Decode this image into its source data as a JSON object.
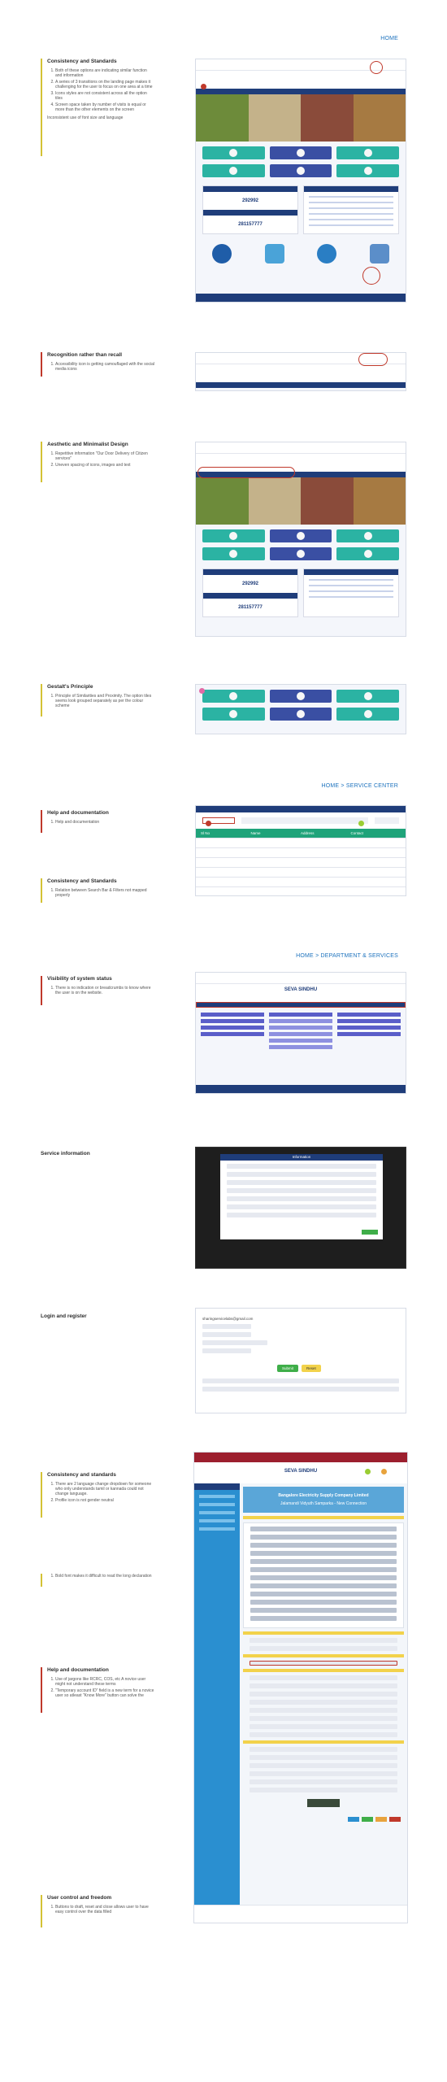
{
  "sections": {
    "home": "HOME",
    "service_center": "HOME > SERVICE CENTER",
    "dept_services": "HOME > DEPARTMENT & SERVICES"
  },
  "notes": {
    "consistency1": {
      "title": "Consistency and Standards",
      "items": [
        "Both of these options are indicating similar function and information",
        "A series of 3 transitions on the landing page makes it challenging for the user to focus on one area at a time",
        "Icons styles are not consistent across all the option tiles",
        "Screen space taken by number of visits is equal or more than the other elements on the screen"
      ],
      "extra": "Inconsistent use of font size and language"
    },
    "recognition": {
      "title": "Recognition rather than recall",
      "items": [
        "Accessibility icon is getting camouflaged with the social media icons"
      ]
    },
    "aesthetic": {
      "title": "Aesthetic and Minimalist Design",
      "items": [
        "Repetitive information \"Our Door Delivery of Citizen services\"",
        "Uneven spacing of icons, images and text"
      ]
    },
    "gestalt": {
      "title": "Gestalt's Principle",
      "items": [
        "Principle of Similarities and Proximity. The option tiles seems look grouped separately as per the colour scheme"
      ]
    },
    "help1": {
      "title": "Help and documentation",
      "items": [
        "Help and documentation"
      ]
    },
    "consistency2": {
      "title": "Consistency and Standards",
      "items": [
        "Relation between Search Bar & Filters not mapped properly"
      ]
    },
    "visibility": {
      "title": "Visibility of system status",
      "items": [
        "There is no indication or breadcrumbs to know where the user is on the website."
      ]
    },
    "service_info": {
      "title": "Service information"
    },
    "login": {
      "title": "Login and register"
    },
    "consistency3": {
      "title": "Consistency and standards",
      "items": [
        "There are 2 language change dropdown for someone who only understands tamil or kannada could not change language.",
        "Profile icon is not gender neutral"
      ]
    },
    "bold": {
      "items": [
        "Bold font makes it difficult to read the long declaration"
      ]
    },
    "help2": {
      "title": "Help and documentation",
      "items": [
        "Use of jargons like RCRC, COS, etc A novice user might not understand these terms",
        "\"Temporary account ID\" field is a new term for a novice user so atleast \"Know More\" button can solve the"
      ]
    },
    "control": {
      "title": "User control and freedom",
      "items": [
        "Buttons to draft, reset and close allows user to have easy control over the data filled"
      ]
    }
  },
  "shots": {
    "home_visits": "292992",
    "home_today": "281157777",
    "dept_title": "SEVA SINDHU",
    "dept_subtitle": "Bangalore Electricity Supply Company Limited",
    "dept_service": "Jalamandi Vidyuth Samparka - New Connection",
    "service_dialog_title": "Information",
    "login_email": "sharingservicelabs@gmail.com",
    "login_submit": "Submit",
    "login_reset": "Reset",
    "table_headers": [
      "Sl No",
      "Name",
      "Address",
      "Contact"
    ]
  },
  "colors": {
    "accent": "#1e73be",
    "navy": "#1f3d7a",
    "teal": "#2bb3a3",
    "blue_tile": "#3a4fa3",
    "issue_red": "#c0392b"
  }
}
